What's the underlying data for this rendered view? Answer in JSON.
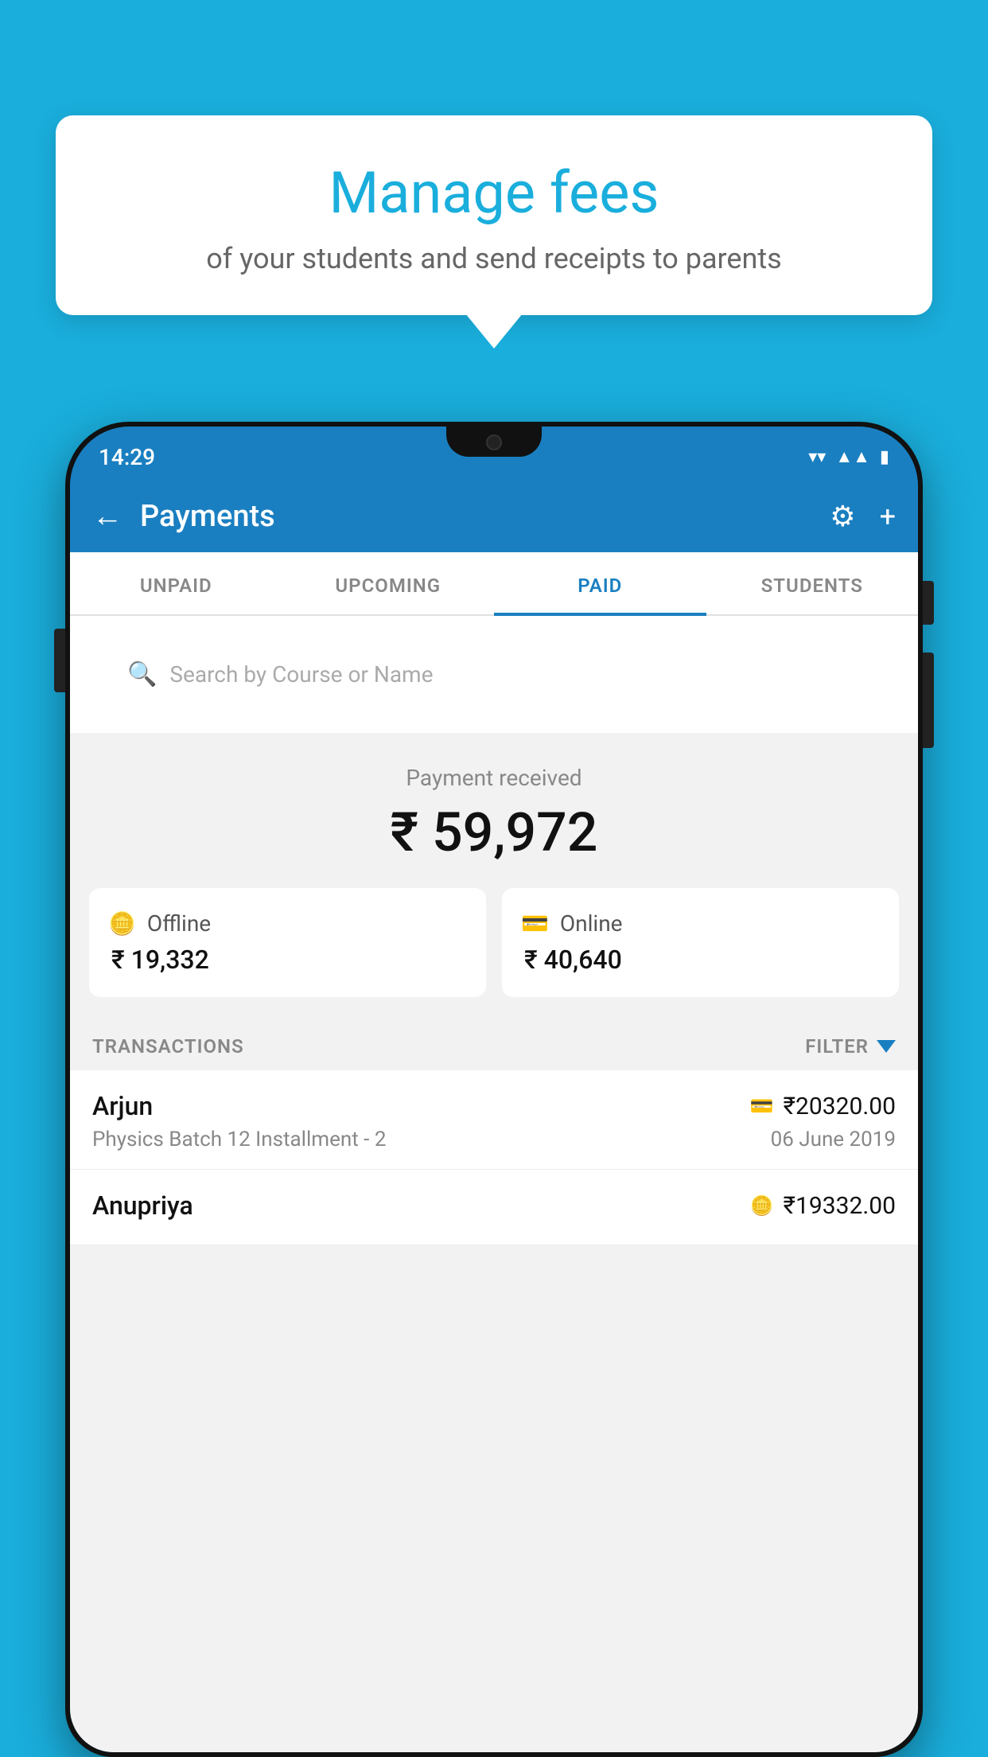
{
  "page": {
    "bg_color": "#1AAEDC"
  },
  "bubble": {
    "title": "Manage fees",
    "subtitle": "of your students and send receipts to parents"
  },
  "status_bar": {
    "time": "14:29"
  },
  "app_bar": {
    "title": "Payments",
    "back_label": "←",
    "settings_label": "⚙",
    "add_label": "+"
  },
  "tabs": [
    {
      "id": "unpaid",
      "label": "UNPAID",
      "active": false
    },
    {
      "id": "upcoming",
      "label": "UPCOMING",
      "active": false
    },
    {
      "id": "paid",
      "label": "PAID",
      "active": true
    },
    {
      "id": "students",
      "label": "STUDENTS",
      "active": false
    }
  ],
  "search": {
    "placeholder": "Search by Course or Name"
  },
  "payment_summary": {
    "label": "Payment received",
    "amount": "₹ 59,972"
  },
  "payment_cards": [
    {
      "id": "offline",
      "icon": "💴",
      "label": "Offline",
      "amount": "₹ 19,332"
    },
    {
      "id": "online",
      "icon": "💳",
      "label": "Online",
      "amount": "₹ 40,640"
    }
  ],
  "transactions": {
    "header_label": "TRANSACTIONS",
    "filter_label": "FILTER"
  },
  "transaction_list": [
    {
      "name": "Arjun",
      "description": "Physics Batch 12 Installment - 2",
      "amount": "₹20320.00",
      "date": "06 June 2019",
      "icon": "💳"
    },
    {
      "name": "Anupriya",
      "description": "",
      "amount": "₹19332.00",
      "date": "",
      "icon": "💴"
    }
  ]
}
